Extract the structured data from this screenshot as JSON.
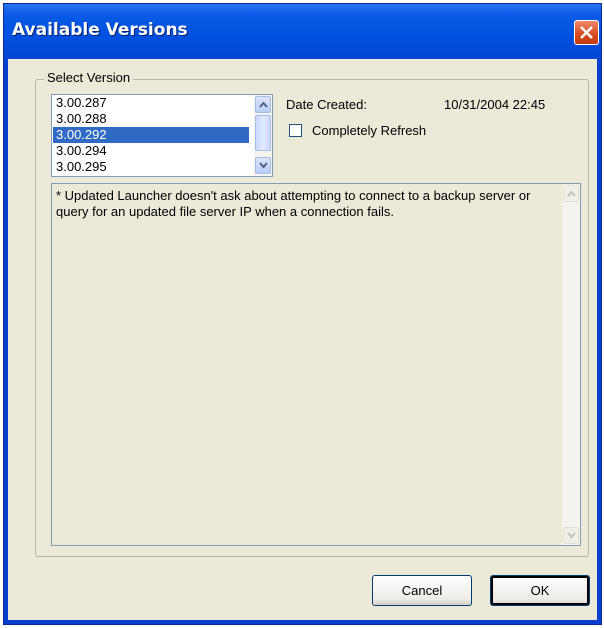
{
  "window": {
    "title": "Available Versions",
    "close_icon": "close-x-icon"
  },
  "group": {
    "label": "Select Version"
  },
  "versions": {
    "items": [
      "3.00.287",
      "3.00.288",
      "3.00.292",
      "3.00.294",
      "3.00.295"
    ],
    "selected": "3.00.292"
  },
  "details": {
    "date_label": "Date Created:",
    "date_value": "10/31/2004 22:45",
    "refresh_label": "Completely Refresh",
    "refresh_checked": false
  },
  "notes": {
    "text": "* Updated Launcher doesn't ask about attempting to connect to a backup server or query for an updated file server IP when a connection fails."
  },
  "buttons": {
    "cancel": "Cancel",
    "ok": "OK"
  },
  "colors": {
    "titlebar": "#0050e0",
    "selection": "#316ac5",
    "dialog_bg": "#ece9d8",
    "close_button": "#d94a1e"
  }
}
